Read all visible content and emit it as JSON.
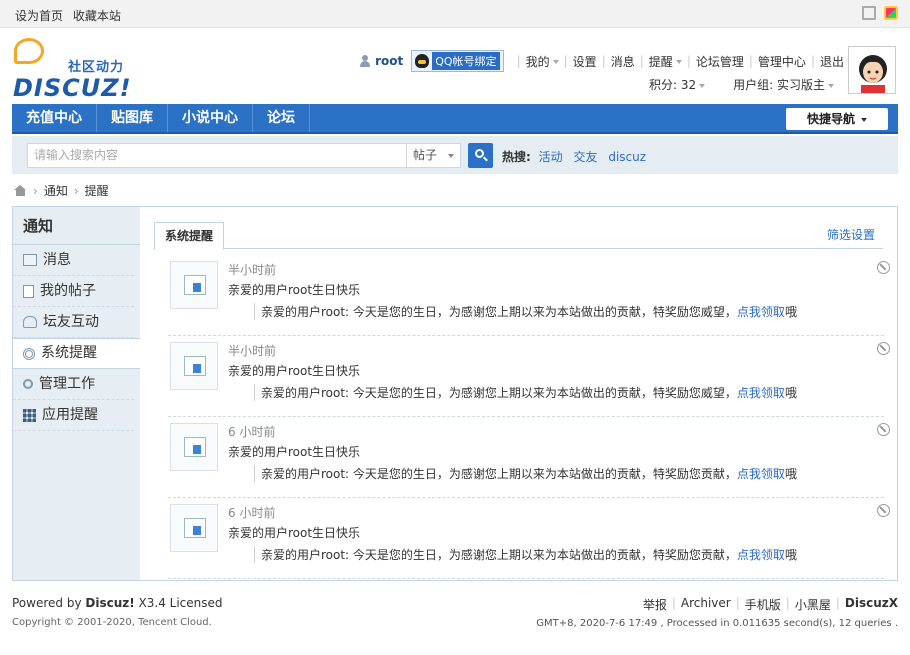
{
  "topbar": {
    "set_home": "设为首页",
    "bookmark": "收藏本站"
  },
  "logo": {
    "tagline": "社区动力",
    "wordmark": "DISCUZ!"
  },
  "user": {
    "name": "root",
    "qq_bind": "QQ帐号绑定",
    "menu": [
      "我的",
      "设置",
      "消息",
      "提醒",
      "论坛管理",
      "管理中心",
      "退出"
    ],
    "credits": "积分: 32",
    "group": "用户组: 实习版主"
  },
  "nav": {
    "items": [
      "充值中心",
      "贴图库",
      "小说中心",
      "论坛"
    ],
    "quick_nav": "快捷导航"
  },
  "search": {
    "placeholder": "请输入搜索内容",
    "type": "帖子",
    "hot_label": "热搜:",
    "hot_keywords": [
      "活动",
      "交友",
      "discuz"
    ]
  },
  "breadcrumb": [
    "通知",
    "提醒"
  ],
  "sidebar": {
    "title": "通知",
    "items": [
      "消息",
      "我的帖子",
      "坛友互动",
      "系统提醒",
      "管理工作",
      "应用提醒"
    ]
  },
  "content": {
    "tab": "系统提醒",
    "filter": "筛选设置",
    "notices": [
      {
        "time": "半小时前",
        "message": "亲爱的用户root生日快乐",
        "detail": "亲爱的用户root: 今天是您的生日，为感谢您上期以来为本站做出的贡献，特奖励您威望，",
        "link": "点我领取",
        "tail": "哦"
      },
      {
        "time": "半小时前",
        "message": "亲爱的用户root生日快乐",
        "detail": "亲爱的用户root: 今天是您的生日，为感谢您上期以来为本站做出的贡献，特奖励您威望，",
        "link": "点我领取",
        "tail": "哦"
      },
      {
        "time": "6 小时前",
        "message": "亲爱的用户root生日快乐",
        "detail": "亲爱的用户root: 今天是您的生日，为感谢您上期以来为本站做出的贡献，特奖励您贡献，",
        "link": "点我领取",
        "tail": "哦"
      },
      {
        "time": "6 小时前",
        "message": "亲爱的用户root生日快乐",
        "detail": "亲爱的用户root: 今天是您的生日，为感谢您上期以来为本站做出的贡献，特奖励您贡献，",
        "link": "点我领取",
        "tail": "哦"
      }
    ]
  },
  "footer": {
    "powered_prefix": "Powered by ",
    "powered_brand": "Discuz!",
    "powered_suffix": " X3.4 Licensed",
    "copyright": "Copyright © 2001-2020, Tencent Cloud.",
    "links": [
      "举报",
      "Archiver",
      "手机版",
      "小黑屋",
      "DiscuzX"
    ],
    "gmt": "GMT+8, 2020-7-6 17:49 , Processed in 0.011635 second(s), 12 queries ."
  },
  "colors": {
    "brand_blue": "#2b72c6",
    "link_blue": "#2b6cc4",
    "sidebar_bg": "#e6eef3"
  }
}
